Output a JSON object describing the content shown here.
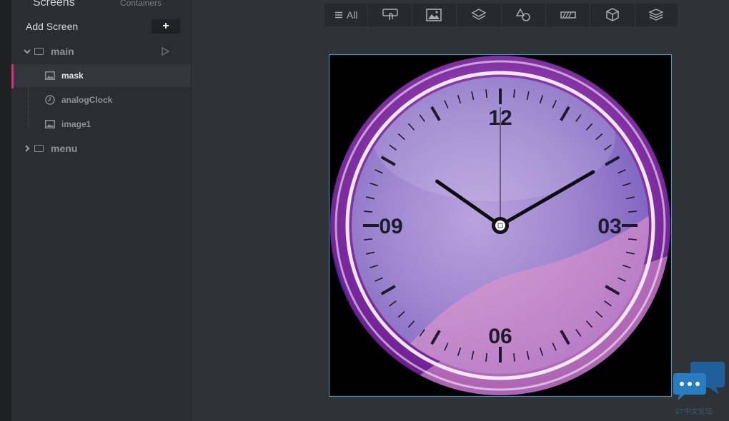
{
  "sidebar": {
    "tabs": {
      "screens": "Screens",
      "containers": "Containers"
    },
    "add_screen": {
      "label": "Add Screen",
      "button": "+"
    },
    "tree": [
      {
        "label": "main",
        "expanded": true,
        "children": [
          {
            "label": "mask",
            "icon": "image-icon",
            "selected": true
          },
          {
            "label": "analogClock",
            "icon": "clock-icon",
            "selected": false
          },
          {
            "label": "image1",
            "icon": "image-icon",
            "selected": false
          }
        ]
      },
      {
        "label": "menu",
        "expanded": false,
        "children": []
      }
    ],
    "accent": "#d6337b"
  },
  "toolbar": {
    "items": [
      {
        "label": "All",
        "icon": "list-icon"
      },
      {
        "label": "",
        "icon": "touch-icon"
      },
      {
        "label": "",
        "icon": "image-icon"
      },
      {
        "label": "",
        "icon": "layers-icon"
      },
      {
        "label": "",
        "icon": "shapes-icon"
      },
      {
        "label": "",
        "icon": "progress-icon"
      },
      {
        "label": "",
        "icon": "cube-icon"
      },
      {
        "label": "",
        "icon": "stack-icon"
      }
    ]
  },
  "clock": {
    "numerals": {
      "n12": "12",
      "n03": "03",
      "n06": "06",
      "n09": "09"
    },
    "time": {
      "hour": 10,
      "minute": 10,
      "second": 0
    },
    "selection_color": "#2aa3d6"
  },
  "watermark": "ST中文论坛"
}
